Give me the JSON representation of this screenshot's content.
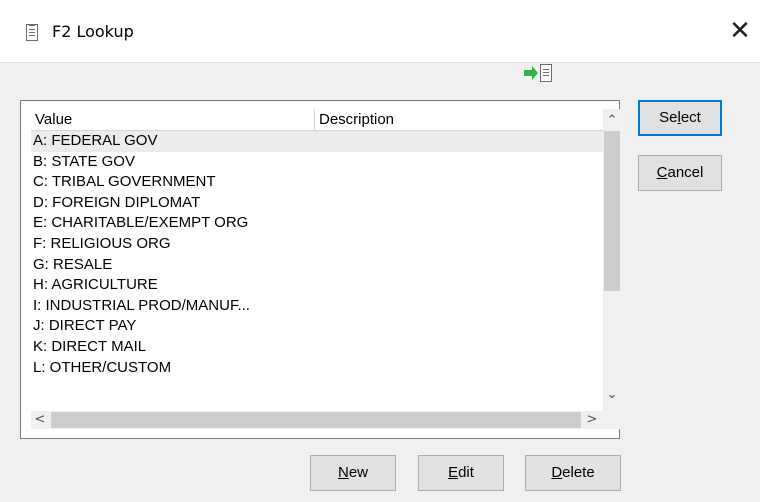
{
  "window": {
    "title": "F2 Lookup",
    "close_glyph": "✕",
    "title_icon": "document-icon"
  },
  "toolbar": {
    "icon": "insert-into-document-icon",
    "icon_color": "#2fb34a"
  },
  "table": {
    "columns": [
      "Value",
      "Description"
    ],
    "rows": [
      {
        "value": "A: FEDERAL GOV",
        "description": ""
      },
      {
        "value": "B: STATE GOV",
        "description": ""
      },
      {
        "value": "C: TRIBAL GOVERNMENT",
        "description": ""
      },
      {
        "value": "D: FOREIGN DIPLOMAT",
        "description": ""
      },
      {
        "value": "E: CHARITABLE/EXEMPT ORG",
        "description": ""
      },
      {
        "value": "F: RELIGIOUS ORG",
        "description": ""
      },
      {
        "value": "G: RESALE",
        "description": ""
      },
      {
        "value": "H: AGRICULTURE",
        "description": ""
      },
      {
        "value": "I: INDUSTRIAL PROD/MANUF...",
        "description": ""
      },
      {
        "value": "J: DIRECT PAY",
        "description": ""
      },
      {
        "value": "K: DIRECT MAIL",
        "description": ""
      },
      {
        "value": "L: OTHER/CUSTOM",
        "description": ""
      }
    ],
    "selected_index": 0,
    "scroll_glyphs": {
      "up": "⌃",
      "down": "⌄",
      "left": "<",
      "right": ">"
    }
  },
  "buttons": {
    "select": {
      "pre": "Se",
      "mn": "l",
      "post": "ect"
    },
    "cancel": {
      "pre": "",
      "mn": "C",
      "post": "ancel"
    },
    "new": {
      "pre": "",
      "mn": "N",
      "post": "ew"
    },
    "edit": {
      "pre": "",
      "mn": "E",
      "post": "dit"
    },
    "delete": {
      "pre": "",
      "mn": "D",
      "post": "elete"
    }
  },
  "colors": {
    "focus_border": "#0078d7",
    "selected_row": "#ececec"
  }
}
